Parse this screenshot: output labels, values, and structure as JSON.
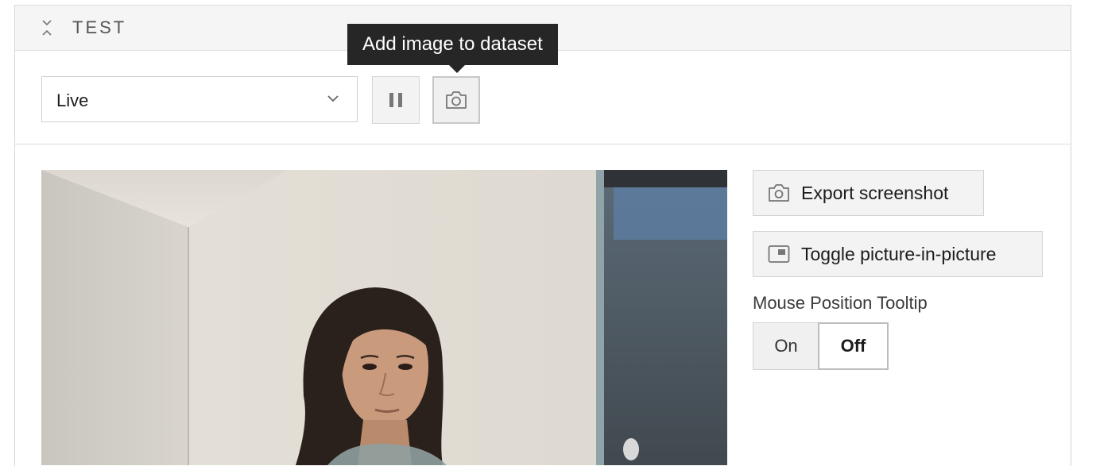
{
  "card": {
    "title": "TEST",
    "collapse_icon": "collapse-chevrons-icon"
  },
  "toolbar": {
    "source_select": {
      "value": "Live",
      "icon": "chevron-down-icon"
    },
    "pause_icon": "pause-icon",
    "camera_icon": "camera-icon",
    "tooltip": "Add image to dataset"
  },
  "video": {
    "description": "live camera feed"
  },
  "side_panel": {
    "export_label": "Export screenshot",
    "export_icon": "camera-icon",
    "pip_label": "Toggle picture-in-picture",
    "pip_icon": "picture-in-picture-icon",
    "mouse_tooltip_label": "Mouse Position Tooltip",
    "toggle": {
      "on_label": "On",
      "off_label": "Off",
      "selected": "Off"
    }
  },
  "colors": {
    "tooltip_bg": "#262626",
    "button_bg": "#f3f3f3",
    "border": "#d4d4d4",
    "header_bg": "#f5f5f5"
  }
}
